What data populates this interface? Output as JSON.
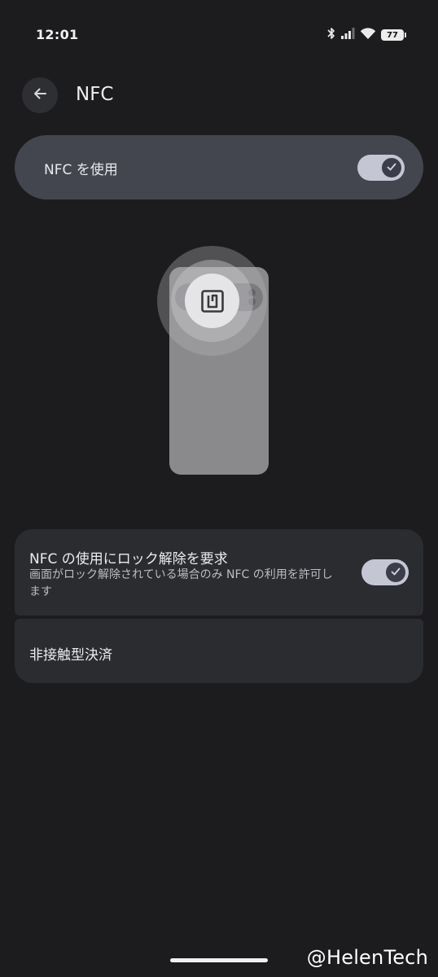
{
  "status_bar": {
    "time": "12:01",
    "battery": "77",
    "icons": [
      "bluetooth-icon",
      "signal-icon",
      "wifi-icon",
      "battery-icon"
    ]
  },
  "app_bar": {
    "title": "NFC",
    "back_icon": "arrow-back-icon"
  },
  "main_toggle": {
    "label": "NFC を使用",
    "checked": true
  },
  "settings": {
    "require_unlock": {
      "title": "NFC の使用にロック解除を要求",
      "summary": "画面がロック解除されている場合のみ NFC の利用を許可します",
      "checked": true
    },
    "contactless_payment": {
      "title": "非接触型決済"
    }
  },
  "watermark": "@HelenTech",
  "colors": {
    "background": "#1c1c1e",
    "main_card": "#44464f",
    "list_card": "#2b2c30",
    "switch_track": "#c5c6d3",
    "switch_thumb": "#3b3d4a"
  }
}
